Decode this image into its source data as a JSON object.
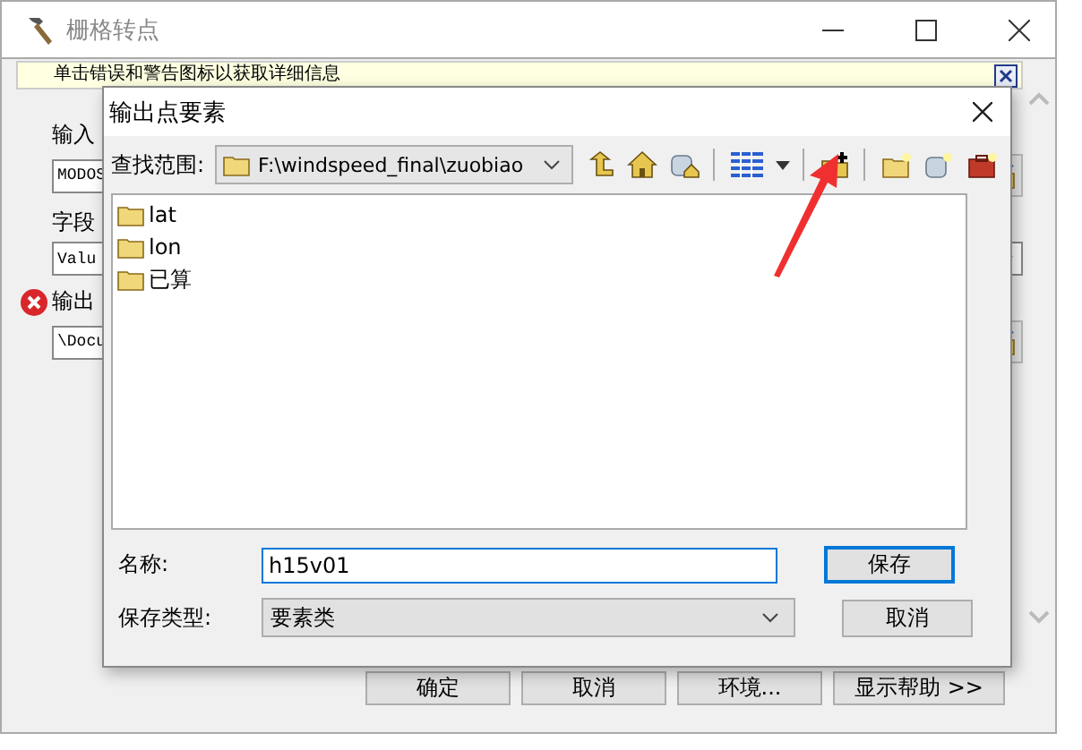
{
  "window": {
    "title": "栅格转点"
  },
  "info_bar": {
    "text": "单击错误和警告图标以获取详细信息"
  },
  "form": {
    "fields": [
      {
        "label": "输入",
        "value": "MODOS",
        "kind": "browse",
        "error": false
      },
      {
        "label": "字段",
        "value": "Valu",
        "kind": "dropdown",
        "error": false
      },
      {
        "label": "输出",
        "value": "\\Docu",
        "kind": "browse",
        "error": true
      }
    ]
  },
  "buttons": [
    "确定",
    "取消",
    "环境...",
    "显示帮助 >>"
  ],
  "dialog": {
    "title": "输出点要素",
    "look_in_label": "查找范围:",
    "look_in": "F:\\windspeed_final\\zuobiao",
    "items": [
      {
        "name": "lat"
      },
      {
        "name": "lon"
      },
      {
        "name": "已算"
      }
    ],
    "name_label": "名称:",
    "name_value": "h15v01",
    "type_label": "保存类型:",
    "type_value": "要素类",
    "buttons": [
      {
        "label": "保存",
        "default": true
      },
      {
        "label": "取消",
        "default": false
      }
    ]
  }
}
